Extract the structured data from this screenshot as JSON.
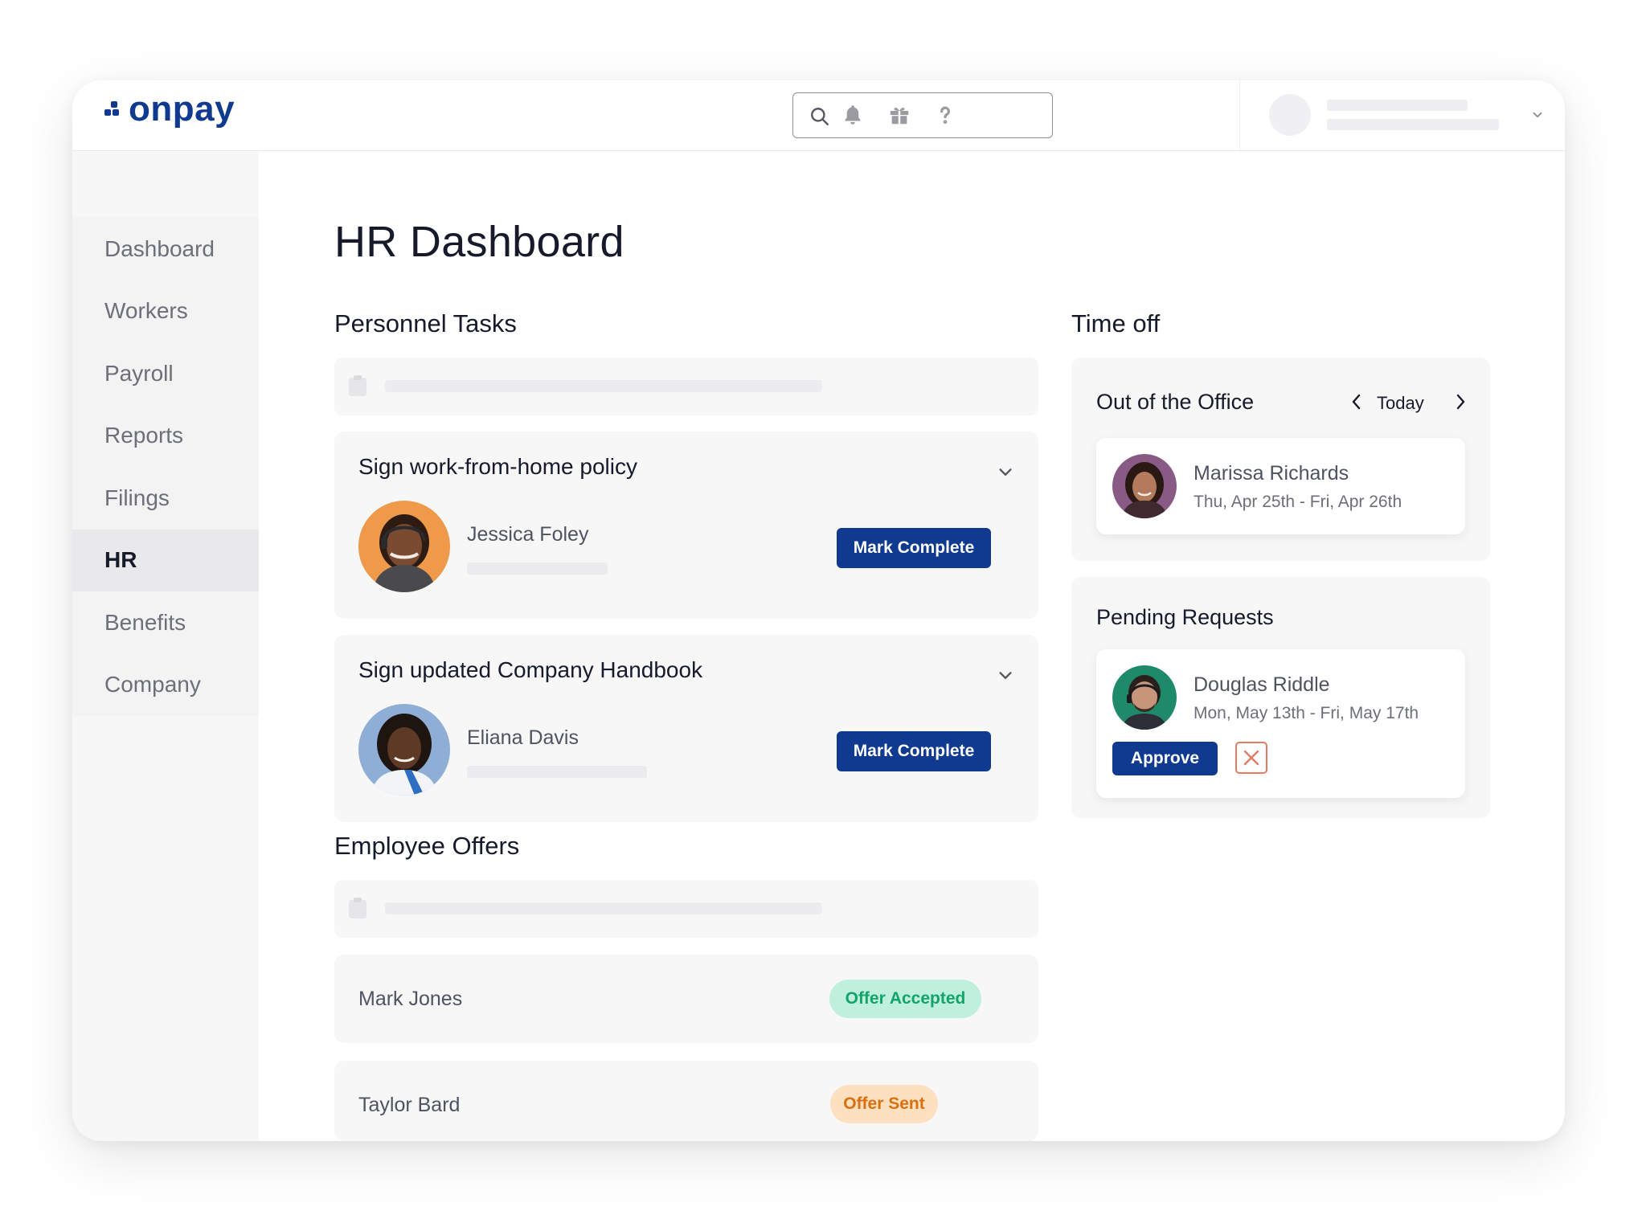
{
  "brand": {
    "logo_text": "onpay",
    "brand_color": "#0f3a8f"
  },
  "header": {
    "search_placeholder": "",
    "icons": [
      "search-icon",
      "bell-icon",
      "gift-icon",
      "help-icon",
      "chevron-down-icon"
    ]
  },
  "sidebar": {
    "items": [
      {
        "label": "Dashboard",
        "active": false
      },
      {
        "label": "Workers",
        "active": false
      },
      {
        "label": "Payroll",
        "active": false
      },
      {
        "label": "Reports",
        "active": false
      },
      {
        "label": "Filings",
        "active": false
      },
      {
        "label": "HR",
        "active": true
      },
      {
        "label": "Benefits",
        "active": false
      },
      {
        "label": "Company",
        "active": false
      }
    ]
  },
  "main": {
    "page_title": "HR Dashboard",
    "personnel_tasks": {
      "title": "Personnel Tasks",
      "tasks": [
        {
          "title": "Sign work-from-home policy",
          "assignee": "Jessica Foley",
          "action_label": "Mark Complete"
        },
        {
          "title": "Sign updated Company Handbook",
          "assignee": "Eliana Davis",
          "action_label": "Mark Complete"
        }
      ]
    },
    "employee_offers": {
      "title": "Employee Offers",
      "offers": [
        {
          "name": "Mark Jones",
          "status": "Offer Accepted",
          "status_color": "#12a46a",
          "status_bg": "#bff0dd"
        },
        {
          "name": "Taylor Bard",
          "status": "Offer Sent",
          "status_color": "#d9700f",
          "status_bg": "#fde0bf"
        }
      ]
    }
  },
  "time_off": {
    "title": "Time off",
    "out_of_office": {
      "title": "Out of the Office",
      "period_label": "Today",
      "entries": [
        {
          "name": "Marissa Richards",
          "dates": "Thu, Apr 25th - Fri, Apr 26th"
        }
      ]
    },
    "pending_requests": {
      "title": "Pending Requests",
      "entries": [
        {
          "name": "Douglas Riddle",
          "dates": "Mon, May 13th - Fri, May 17th",
          "approve_label": "Approve",
          "deny_icon": "close-icon"
        }
      ]
    }
  }
}
